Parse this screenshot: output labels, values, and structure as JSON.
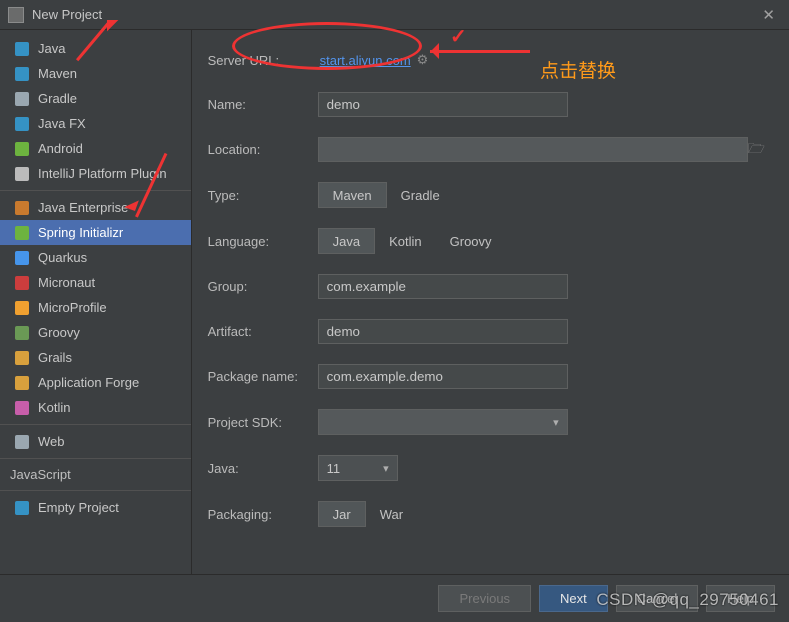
{
  "window": {
    "title": "New Project"
  },
  "sidebar": {
    "items": [
      {
        "label": "Java",
        "icon": "folder-icon",
        "color": "#3592c4"
      },
      {
        "label": "Maven",
        "icon": "maven-icon",
        "color": "#3592c4"
      },
      {
        "label": "Gradle",
        "icon": "gradle-icon",
        "color": "#9aa7b0"
      },
      {
        "label": "Java FX",
        "icon": "folder-icon",
        "color": "#3592c4"
      },
      {
        "label": "Android",
        "icon": "android-icon",
        "color": "#6db33f"
      },
      {
        "label": "IntelliJ Platform Plugin",
        "icon": "intellij-icon",
        "color": "#bbbbbb"
      },
      {
        "label": "Java Enterprise",
        "icon": "jee-icon",
        "color": "#c97a2e"
      },
      {
        "label": "Spring Initializr",
        "icon": "spring-icon",
        "color": "#6db33f",
        "selected": true
      },
      {
        "label": "Quarkus",
        "icon": "quarkus-icon",
        "color": "#4695eb"
      },
      {
        "label": "Micronaut",
        "icon": "micronaut-icon",
        "color": "#cc3d3d"
      },
      {
        "label": "MicroProfile",
        "icon": "microprofile-icon",
        "color": "#f0a030"
      },
      {
        "label": "Groovy",
        "icon": "groovy-icon",
        "color": "#6a9955"
      },
      {
        "label": "Grails",
        "icon": "grails-icon",
        "color": "#d8a03d"
      },
      {
        "label": "Application Forge",
        "icon": "forge-icon",
        "color": "#d8a03d"
      },
      {
        "label": "Kotlin",
        "icon": "kotlin-icon",
        "color": "#c75eaa"
      },
      {
        "label": "Web",
        "icon": "web-icon",
        "color": "#9aa7b0"
      }
    ],
    "section_label": "JavaScript",
    "empty_project_label": "Empty Project"
  },
  "form": {
    "server_url_label": "Server URL:",
    "server_url_value": "start.aliyun.com",
    "name_label": "Name:",
    "name_value": "demo",
    "location_label": "Location:",
    "location_value": "",
    "type_label": "Type:",
    "type_options": [
      "Maven",
      "Gradle"
    ],
    "type_selected": "Maven",
    "language_label": "Language:",
    "language_options": [
      "Java",
      "Kotlin",
      "Groovy"
    ],
    "language_selected": "Java",
    "group_label": "Group:",
    "group_value": "com.example",
    "artifact_label": "Artifact:",
    "artifact_value": "demo",
    "package_label": "Package name:",
    "package_value": "com.example.demo",
    "sdk_label": "Project SDK:",
    "sdk_value": "",
    "java_label": "Java:",
    "java_value": "11",
    "packaging_label": "Packaging:",
    "packaging_options": [
      "Jar",
      "War"
    ],
    "packaging_selected": "Jar"
  },
  "footer": {
    "previous": "Previous",
    "next": "Next",
    "cancel": "Cancel",
    "help": "Help"
  },
  "annotation": {
    "hint_text": "点击替换"
  },
  "watermark": "CSDN @qq_29750461"
}
